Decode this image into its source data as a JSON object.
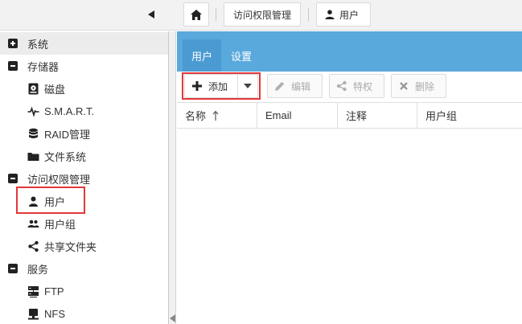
{
  "breadcrumb": {
    "home_icon": "home-icon",
    "items": [
      "访问权限管理",
      "用户"
    ]
  },
  "sidebar": {
    "categories": [
      {
        "label": "系统",
        "state": "collapsed"
      },
      {
        "label": "存储器",
        "state": "expanded",
        "items": [
          {
            "label": "磁盘",
            "icon": "disk-icon"
          },
          {
            "label": "S.M.A.R.T.",
            "icon": "heartbeat-icon"
          },
          {
            "label": "RAID管理",
            "icon": "database-icon"
          },
          {
            "label": "文件系统",
            "icon": "folder-icon"
          }
        ]
      },
      {
        "label": "访问权限管理",
        "state": "expanded",
        "items": [
          {
            "label": "用户",
            "icon": "user-icon",
            "selected": true
          },
          {
            "label": "用户组",
            "icon": "users-icon"
          },
          {
            "label": "共享文件夹",
            "icon": "share-icon"
          }
        ]
      },
      {
        "label": "服务",
        "state": "expanded",
        "items": [
          {
            "label": "FTP",
            "icon": "server-icon"
          },
          {
            "label": "NFS",
            "icon": "desktop-icon"
          }
        ]
      }
    ]
  },
  "tabs": [
    {
      "label": "用户",
      "active": true
    },
    {
      "label": "设置",
      "active": false
    }
  ],
  "toolbar": {
    "add": "添加",
    "edit": "编辑",
    "privileges": "特权",
    "delete": "删除"
  },
  "grid": {
    "columns": [
      "名称",
      "Email",
      "注释",
      "用户组"
    ],
    "sort_column": "名称",
    "sort_direction": "ascending",
    "rows": []
  },
  "colors": {
    "accent": "#5aa9dc",
    "highlight_box": "#e2383a"
  }
}
